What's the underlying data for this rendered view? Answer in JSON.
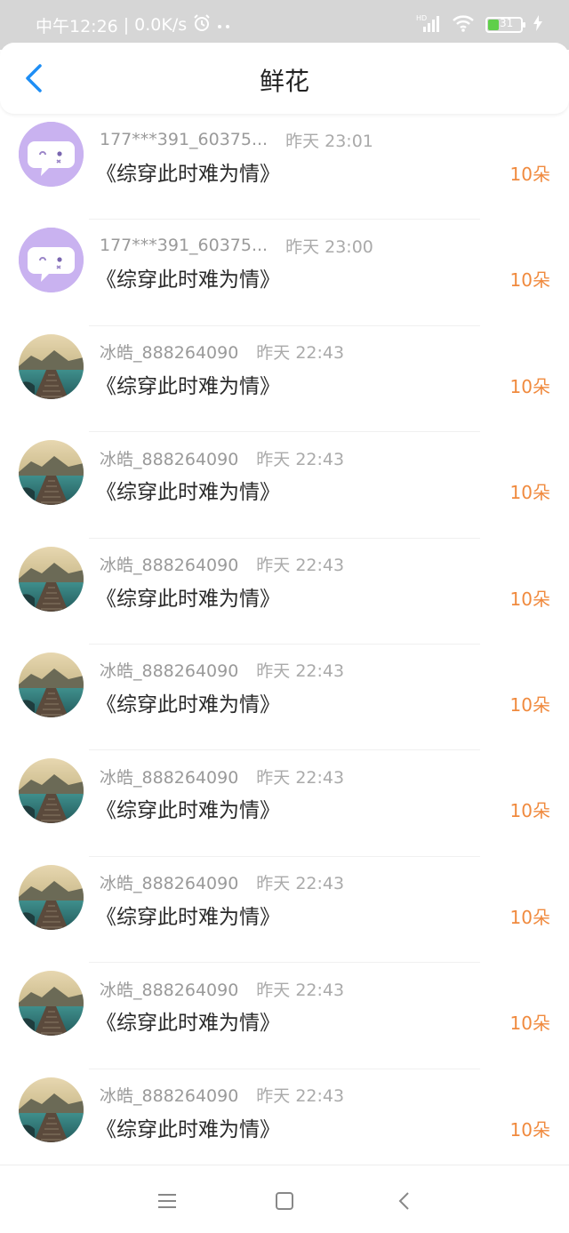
{
  "status_bar": {
    "time": "中午12:26",
    "speed": "0.0K/s",
    "battery": "31",
    "signal_label": "HD"
  },
  "header": {
    "title": "鲜花",
    "back_icon": "chevron-left-icon"
  },
  "gifts": [
    {
      "user": "177***391_60375...",
      "time": "昨天 23:01",
      "book": "《综穿此时难为情》",
      "count": "10朵",
      "avatar": "chat-bubble-face"
    },
    {
      "user": "177***391_60375...",
      "time": "昨天 23:00",
      "book": "《综穿此时难为情》",
      "count": "10朵",
      "avatar": "chat-bubble-face"
    },
    {
      "user": "冰皓_888264090",
      "time": "昨天 22:43",
      "book": "《综穿此时难为情》",
      "count": "10朵",
      "avatar": "lake-pier-photo"
    },
    {
      "user": "冰皓_888264090",
      "time": "昨天 22:43",
      "book": "《综穿此时难为情》",
      "count": "10朵",
      "avatar": "lake-pier-photo"
    },
    {
      "user": "冰皓_888264090",
      "time": "昨天 22:43",
      "book": "《综穿此时难为情》",
      "count": "10朵",
      "avatar": "lake-pier-photo"
    },
    {
      "user": "冰皓_888264090",
      "time": "昨天 22:43",
      "book": "《综穿此时难为情》",
      "count": "10朵",
      "avatar": "lake-pier-photo"
    },
    {
      "user": "冰皓_888264090",
      "time": "昨天 22:43",
      "book": "《综穿此时难为情》",
      "count": "10朵",
      "avatar": "lake-pier-photo"
    },
    {
      "user": "冰皓_888264090",
      "time": "昨天 22:43",
      "book": "《综穿此时难为情》",
      "count": "10朵",
      "avatar": "lake-pier-photo"
    },
    {
      "user": "冰皓_888264090",
      "time": "昨天 22:43",
      "book": "《综穿此时难为情》",
      "count": "10朵",
      "avatar": "lake-pier-photo"
    },
    {
      "user": "冰皓_888264090",
      "time": "昨天 22:43",
      "book": "《综穿此时难为情》",
      "count": "10朵",
      "avatar": "lake-pier-photo"
    }
  ],
  "colors": {
    "accent_blue": "#1e8ef5",
    "count_orange": "#f08a3e",
    "avatar_purple": "#c9b2f0"
  },
  "nav": {
    "menu_icon": "menu-icon",
    "home_icon": "home-square-icon",
    "back_icon": "back-triangle-icon"
  }
}
